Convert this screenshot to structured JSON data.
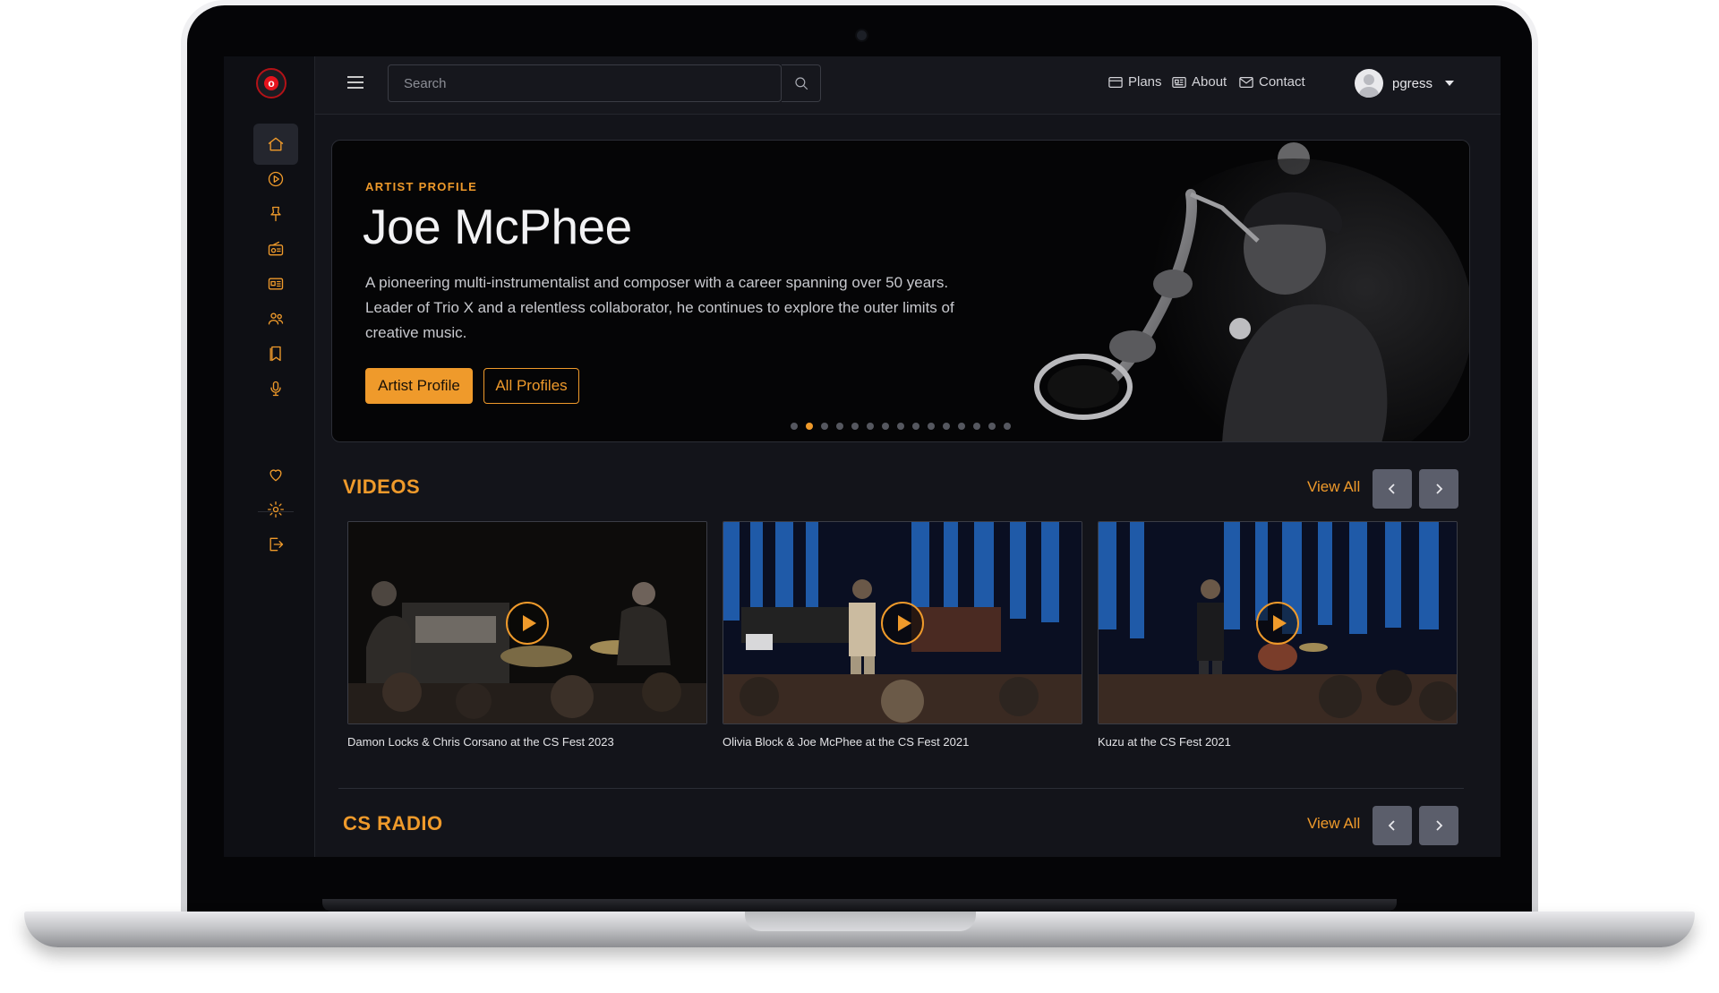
{
  "colors": {
    "accent": "#ef9a2b",
    "background": "#13141a",
    "sidebar": "#0e0f14",
    "logo_red": "#e5121c"
  },
  "logo": {
    "letter": "o"
  },
  "sidebar": {
    "items": [
      {
        "icon": "home-icon",
        "active": true
      },
      {
        "icon": "play-circle-icon"
      },
      {
        "icon": "pin-icon"
      },
      {
        "icon": "radio-icon"
      },
      {
        "icon": "newspaper-icon"
      },
      {
        "icon": "users-icon"
      },
      {
        "icon": "bookmark-icon"
      },
      {
        "icon": "microphone-icon"
      },
      {
        "icon": "heart-icon"
      },
      {
        "icon": "gear-icon"
      },
      {
        "icon": "logout-icon"
      }
    ]
  },
  "topbar": {
    "search_placeholder": "Search",
    "nav": [
      {
        "label": "Plans",
        "icon": "card-icon"
      },
      {
        "label": "About",
        "icon": "newspaper-icon"
      },
      {
        "label": "Contact",
        "icon": "envelope-icon"
      }
    ],
    "user": {
      "name": "pgress"
    }
  },
  "hero": {
    "eyebrow": "ARTIST PROFILE",
    "title": "Joe McPhee",
    "description": "A pioneering multi-instrumentalist and composer with a career spanning over 50 years. Leader of Trio X and a relentless collaborator, he continues to explore the outer limits of creative music.",
    "primary_button": "Artist Profile",
    "secondary_button": "All Profiles",
    "carousel": {
      "total_slides": 15,
      "active_index": 1
    }
  },
  "videos": {
    "title": "VIDEOS",
    "view_all": "View All",
    "items": [
      {
        "caption": "Damon Locks & Chris Corsano at the CS Fest 2023"
      },
      {
        "caption": "Olivia Block & Joe McPhee at the CS Fest 2021"
      },
      {
        "caption": "Kuzu at the CS Fest 2021"
      }
    ]
  },
  "radio": {
    "title": "CS RADIO",
    "view_all": "View All"
  }
}
